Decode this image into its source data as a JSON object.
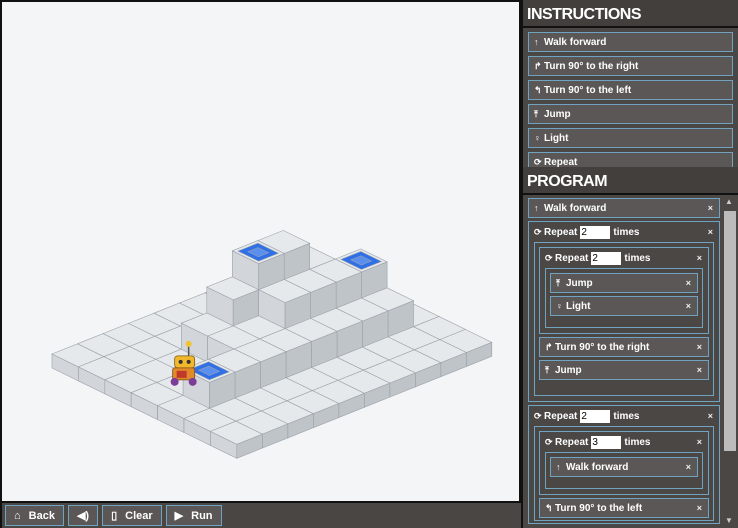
{
  "toolbar": {
    "back": "Back",
    "clear": "Clear",
    "run": "Run",
    "icons": {
      "back": "home-icon",
      "sound": "speaker-icon",
      "clear": "page-icon",
      "run": "play-icon"
    }
  },
  "instructions": {
    "title": "INSTRUCTIONS",
    "items": [
      {
        "icon": "↑",
        "label": "Walk forward"
      },
      {
        "icon": "↱",
        "label": "Turn 90° to the right"
      },
      {
        "icon": "↰",
        "label": "Turn 90° to the left"
      },
      {
        "icon": "⤒",
        "label": "Jump"
      },
      {
        "icon": "♀",
        "label": "Light"
      },
      {
        "icon": "⟳",
        "label": "Repeat"
      }
    ]
  },
  "program": {
    "title": "PROGRAM",
    "times": "times",
    "repeat": "Repeat",
    "close": "×",
    "walk1": "Walk forward",
    "rep1": {
      "count": "2",
      "inner": {
        "count": "2",
        "jump": "Jump",
        "light": "Light"
      },
      "turn_right": "Turn 90° to the right",
      "jump": "Jump"
    },
    "rep2": {
      "count": "2",
      "inner": {
        "count": "3",
        "walk": "Walk forward"
      },
      "turn_left": "Turn 90° to the left"
    }
  },
  "level": {
    "colors": {
      "top": "#e6e9ec",
      "left": "#d2d6da",
      "right": "#bfc4c9",
      "goal": "#2f6fe8"
    },
    "heights": [
      [
        0,
        0,
        0,
        0,
        0,
        0,
        0,
        0,
        0,
        0
      ],
      [
        0,
        0,
        0,
        0,
        0,
        0,
        0,
        0,
        0,
        0
      ],
      [
        0,
        0,
        0,
        1,
        2,
        3,
        3,
        2,
        0,
        0
      ],
      [
        0,
        0,
        0,
        1,
        1,
        2,
        2,
        2,
        2,
        0
      ],
      [
        0,
        1,
        1,
        1,
        1,
        1,
        1,
        1,
        1,
        0
      ],
      [
        0,
        0,
        0,
        0,
        0,
        0,
        0,
        0,
        0,
        0
      ],
      [
        0,
        0,
        0,
        0,
        0,
        0,
        0,
        0,
        0,
        0
      ]
    ],
    "goals": [
      [
        4,
        1
      ],
      [
        2,
        5
      ],
      [
        3,
        8
      ]
    ],
    "robot": [
      3,
      1
    ]
  }
}
